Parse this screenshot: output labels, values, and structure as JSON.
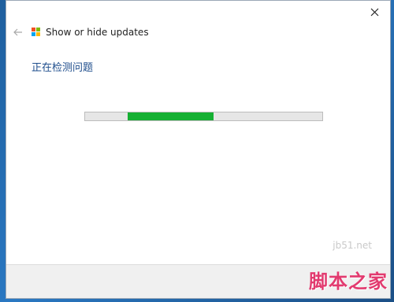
{
  "window": {
    "title": "Show or hide updates",
    "status_text": "正在检测问题"
  },
  "progress": {
    "indeterminate": true,
    "segment_start": 0.18,
    "segment_fraction": 0.36,
    "fill_color": "#16b033",
    "track_color": "#e6e6e6"
  },
  "icons": {
    "back": "back-arrow-icon",
    "close": "close-icon",
    "app": "windows-logo-icon"
  },
  "logo_colors": [
    "#f25022",
    "#7fba00",
    "#00a4ef",
    "#ffb900"
  ],
  "watermark": {
    "sub": "jb51.net",
    "main": "脚本之家"
  }
}
